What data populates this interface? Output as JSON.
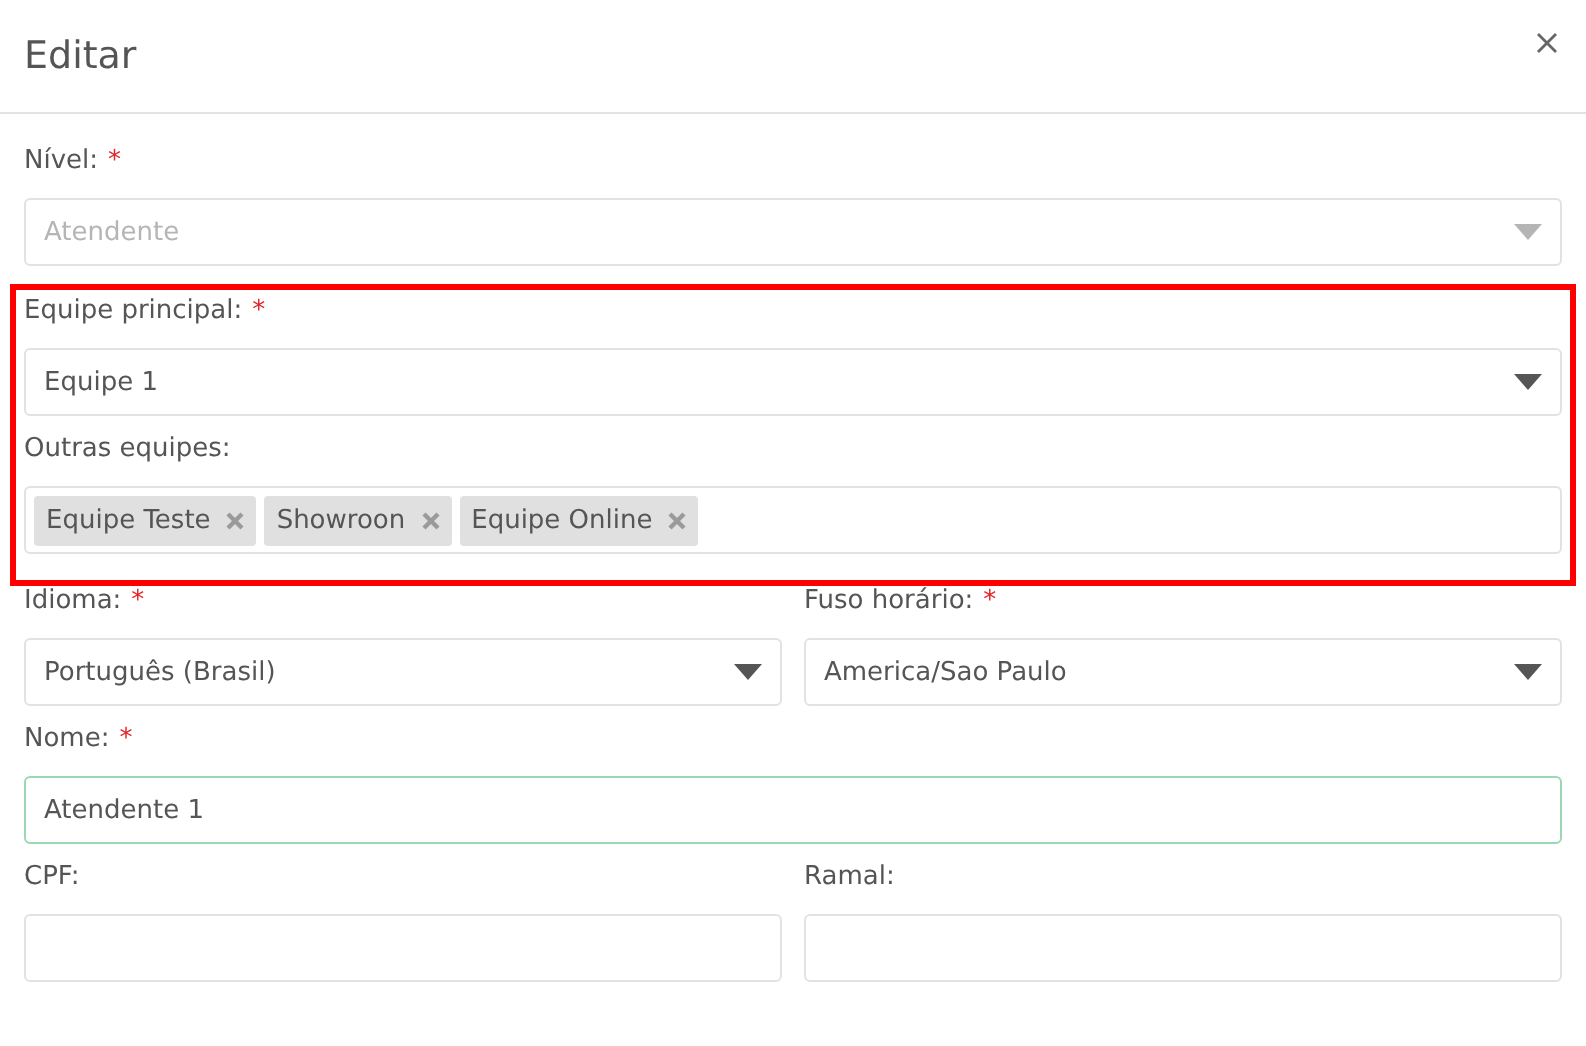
{
  "dialog": {
    "title": "Editar"
  },
  "sections": [
    {
      "highlighted": false,
      "rows": [
        [
          {
            "kind": "select",
            "label": "Nível:",
            "required_mark": "*",
            "value": "Atendente",
            "disabled": true
          }
        ]
      ]
    },
    {
      "highlighted": true,
      "rows": [
        [
          {
            "kind": "select",
            "label": "Equipe principal:",
            "required_mark": "*",
            "value": "Equipe 1",
            "disabled": false
          }
        ],
        [
          {
            "kind": "tags",
            "label": "Outras equipes:",
            "tags": [
              "Equipe Teste",
              "Showroon",
              "Equipe Online"
            ]
          }
        ]
      ]
    },
    {
      "highlighted": false,
      "rows": [
        [
          {
            "kind": "select",
            "label": "Idioma:",
            "required_mark": "*",
            "value": "Português (Brasil)",
            "disabled": false
          },
          {
            "kind": "select",
            "label": "Fuso horário:",
            "required_mark": "*",
            "value": "America/Sao Paulo",
            "disabled": false
          }
        ],
        [
          {
            "kind": "text",
            "label": "Nome:",
            "required_mark": "*",
            "value": "Atendente 1",
            "focused": true
          }
        ],
        [
          {
            "kind": "text",
            "label": "CPF:",
            "focused": false
          },
          {
            "kind": "text",
            "label": "Ramal:",
            "focused": false
          }
        ]
      ]
    }
  ]
}
